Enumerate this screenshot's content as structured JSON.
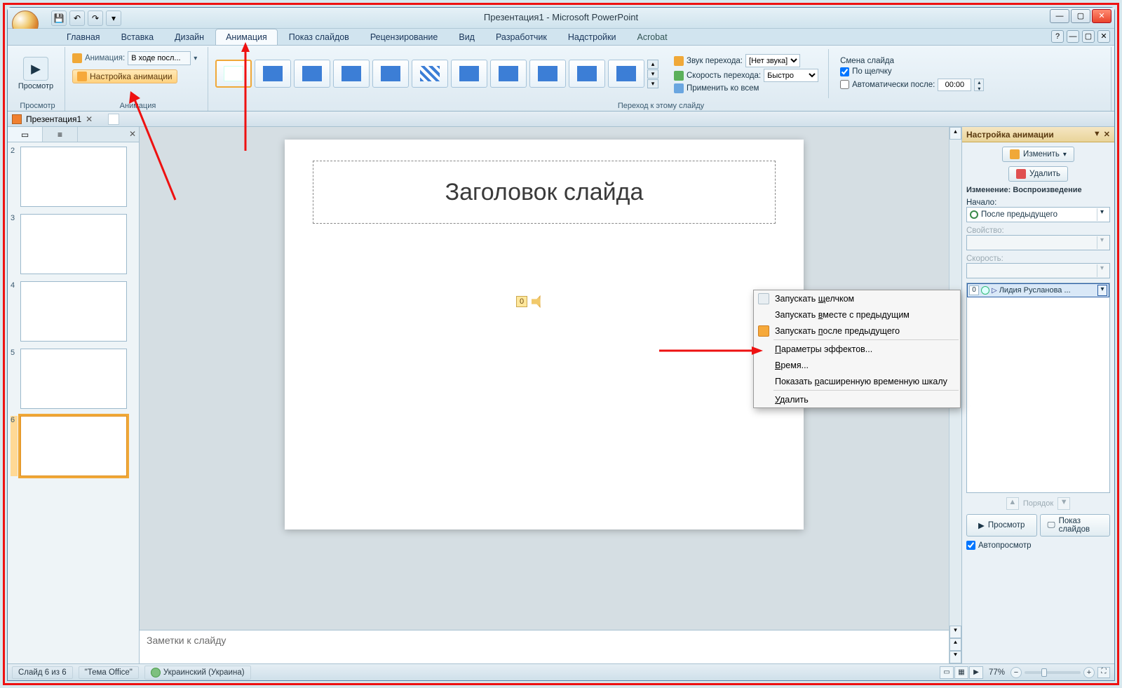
{
  "title": "Презентация1 - Microsoft PowerPoint",
  "qat": {
    "save": "💾",
    "undo": "↶",
    "redo": "↷",
    "more": "▾"
  },
  "tabs": {
    "home": "Главная",
    "insert": "Вставка",
    "design": "Дизайн",
    "animation": "Анимация",
    "slideshow": "Показ слайдов",
    "review": "Рецензирование",
    "view": "Вид",
    "developer": "Разработчик",
    "addins": "Надстройки",
    "acrobat": "Acrobat"
  },
  "ribbon": {
    "preview_btn": "Просмотр",
    "preview_group": "Просмотр",
    "anim_label": "Анимация:",
    "anim_value": "В ходе посл...",
    "custom_anim": "Настройка анимации",
    "anim_group": "Анимация",
    "trans_group": "Переход к этому слайду",
    "sound_label": "Звук перехода:",
    "sound_value": "[Нет звука]",
    "speed_label": "Скорость перехода:",
    "speed_value": "Быстро",
    "apply_all": "Применить ко всем",
    "change_header": "Смена слайда",
    "on_click": "По щелчку",
    "auto_after": "Автоматически после:",
    "auto_time": "00:00"
  },
  "doc_tab": "Презентация1",
  "left": {
    "slides": [
      {
        "n": "2"
      },
      {
        "n": "3"
      },
      {
        "n": "4"
      },
      {
        "n": "5"
      },
      {
        "n": "6",
        "selected": true
      }
    ]
  },
  "slide": {
    "title_placeholder": "Заголовок слайда",
    "sound_idx": "0"
  },
  "notes_placeholder": "Заметки к слайду",
  "taskpane": {
    "title": "Настройка анимации",
    "change_btn": "Изменить",
    "remove_btn": "Удалить",
    "mod_header": "Изменение: Воспроизведение",
    "start_label": "Начало:",
    "start_value": "После предыдущего",
    "prop_label": "Свойство:",
    "speed_label": "Скорость:",
    "effect_n": "0",
    "effect_text": "Лидия Русланова ...",
    "reorder": "Порядок",
    "preview": "Просмотр",
    "slideshow": "Показ слайдов",
    "autoprev": "Автопросмотр"
  },
  "context": {
    "on_click": "Запускать щелчком",
    "with_prev": "Запускать вместе с предыдущим",
    "after_prev": "Запускать после предыдущего",
    "effect_opts": "Параметры эффектов...",
    "timing": "Время...",
    "adv_timeline": "Показать расширенную временную шкалу",
    "remove": "Удалить",
    "u_click": "щ",
    "u_with": "в",
    "u_after": "п",
    "u_eff": "П",
    "u_time": "В",
    "u_adv": "р",
    "u_rem": "У"
  },
  "status": {
    "slide_of": "Слайд 6 из 6",
    "theme": "\"Тема Office\"",
    "lang": "Украинский (Украина)",
    "zoom": "77%"
  }
}
